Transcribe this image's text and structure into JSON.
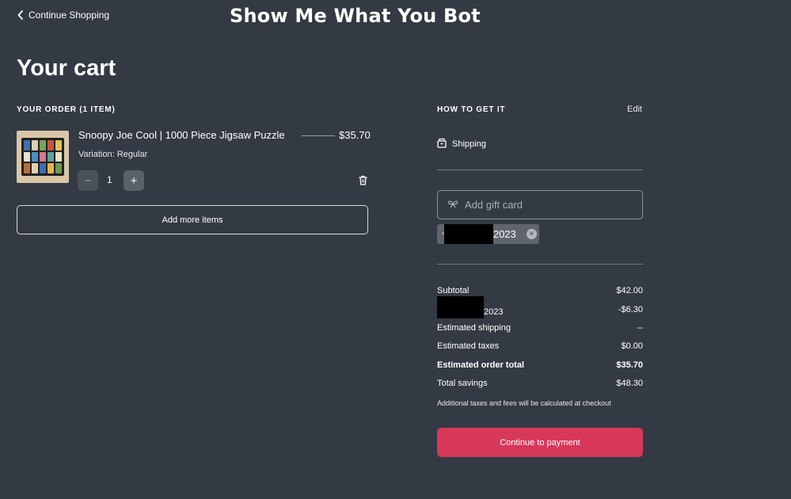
{
  "header": {
    "back_label": "Continue Shopping",
    "brand": "Show Me What You Bot"
  },
  "page_title": "Your cart",
  "order": {
    "heading": "YOUR ORDER (1 ITEM)",
    "items": [
      {
        "name": "Snoopy Joe Cool | 1000 Piece Jigsaw Puzzle",
        "price": "$35.70",
        "variation": "Variation: Regular",
        "quantity": "1",
        "minus_symbol": "−",
        "plus_symbol": "+"
      }
    ],
    "add_more_label": "Add more items"
  },
  "delivery": {
    "heading": "HOW TO GET IT",
    "edit_label": "Edit",
    "method": "Shipping"
  },
  "gift_card": {
    "placeholder": "Add gift card",
    "applied_code_visible": "2023",
    "remove_symbol": "×"
  },
  "summary": {
    "rows": [
      {
        "label": "Subtotal",
        "value": "$42.00"
      },
      {
        "label": "2023",
        "value": "-$6.30"
      },
      {
        "label": "Estimated shipping",
        "value": "--"
      },
      {
        "label": "Estimated taxes",
        "value": "$0.00"
      },
      {
        "label": "Estimated order total",
        "value": "$35.70"
      },
      {
        "label": "Total savings",
        "value": "$48.30"
      }
    ],
    "note": "Additional taxes and fees will be calculated at checkout",
    "pay_label": "Continue to payment"
  },
  "colors": {
    "background": "#343a43",
    "accent": "#d7385a",
    "chip": "#5f656d"
  }
}
